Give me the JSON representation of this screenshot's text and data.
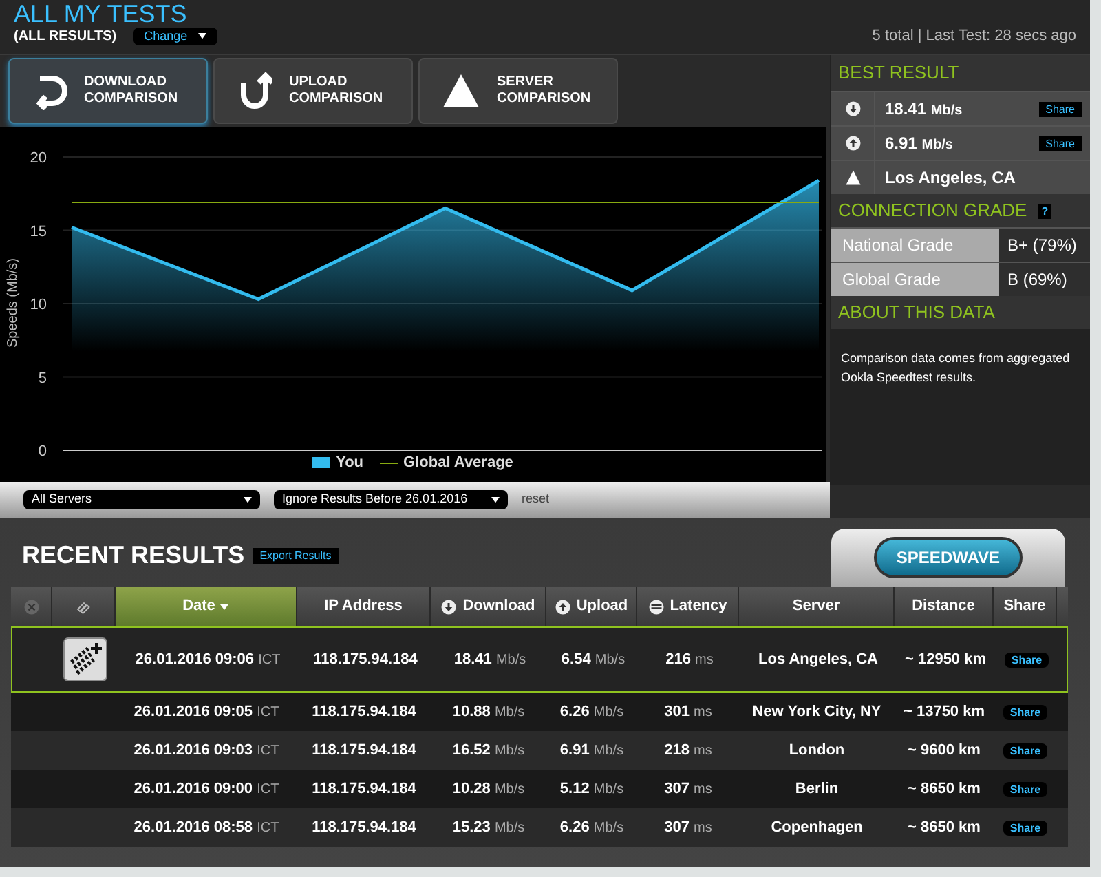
{
  "header": {
    "title": "ALL MY TESTS",
    "subtitle": "(ALL RESULTS)",
    "change_button": "Change",
    "summary": "5 total | Last Test: 28 secs ago"
  },
  "tabs": [
    {
      "label": "DOWNLOAD\nCOMPARISON",
      "kind": "download",
      "selected": true
    },
    {
      "label": "UPLOAD\nCOMPARISON",
      "kind": "upload",
      "selected": false
    },
    {
      "label": "SERVER\nCOMPARISON",
      "kind": "server",
      "selected": false
    }
  ],
  "chart": {
    "chart_data": {
      "type": "area",
      "ylabel": "Speeds (Mb/s)",
      "grid": true,
      "legend": "bottom",
      "ylim": [
        0,
        20
      ],
      "yticks": [
        0,
        5,
        10,
        15,
        20
      ],
      "series": [
        {
          "name": "You",
          "type": "area",
          "color": "#33bbee",
          "values": [
            15.2,
            10.3,
            16.5,
            10.9,
            18.4
          ]
        },
        {
          "name": "Global Average",
          "type": "line",
          "color": "#88aa11",
          "values": [
            16.9,
            16.9,
            16.9,
            16.9,
            16.9
          ]
        }
      ]
    }
  },
  "filters": {
    "server_select": "All Servers",
    "date_select": "Ignore Results Before 26.01.2016",
    "reset": "reset"
  },
  "best_result": {
    "title": "BEST RESULT",
    "rows": [
      {
        "kind": "download",
        "value": "18.41",
        "unit": "Mb/s",
        "share": "Share"
      },
      {
        "kind": "upload",
        "value": "6.91",
        "unit": "Mb/s",
        "share": "Share"
      },
      {
        "kind": "server",
        "value": "Los Angeles, CA"
      }
    ]
  },
  "connection_grade": {
    "title": "CONNECTION GRADE",
    "help": "?",
    "rows": [
      {
        "label": "National Grade",
        "value": "B+ (79%)"
      },
      {
        "label": "Global Grade",
        "value": "B (69%)"
      }
    ]
  },
  "about": {
    "title": "ABOUT THIS DATA",
    "text": "Comparison data comes from aggregated Ookla Speedtest results."
  },
  "recent": {
    "title": "RECENT RESULTS",
    "export_button": "Export Results",
    "speedwave_button": "SPEEDWAVE",
    "columns": [
      {
        "kind": "close",
        "selected": false
      },
      {
        "kind": "stack",
        "selected": false
      },
      {
        "label": "Date",
        "kind": "text",
        "selected": true
      },
      {
        "label": "IP Address",
        "kind": "text",
        "selected": false
      },
      {
        "label": "Download",
        "kind": "download",
        "selected": false
      },
      {
        "label": "Upload",
        "kind": "upload",
        "selected": false
      },
      {
        "label": "Latency",
        "kind": "latency",
        "selected": false
      },
      {
        "label": "Server",
        "kind": "text",
        "selected": false
      },
      {
        "label": "Distance",
        "kind": "text",
        "selected": false
      },
      {
        "label": "Share",
        "kind": "text",
        "selected": false
      }
    ],
    "rows": [
      {
        "selected": true,
        "date": "26.01.2016 09:06",
        "tz": "ICT",
        "ip": "118.175.94.184",
        "download": "18.41",
        "download_unit": "Mb/s",
        "upload": "6.54",
        "upload_unit": "Mb/s",
        "latency": "216",
        "latency_unit": "ms",
        "server": "Los Angeles, CA",
        "distance": "~ 12950 km",
        "share": "Share"
      },
      {
        "selected": false,
        "date": "26.01.2016 09:05",
        "tz": "ICT",
        "ip": "118.175.94.184",
        "download": "10.88",
        "download_unit": "Mb/s",
        "upload": "6.26",
        "upload_unit": "Mb/s",
        "latency": "301",
        "latency_unit": "ms",
        "server": "New York City, NY",
        "distance": "~ 13750 km",
        "share": "Share"
      },
      {
        "selected": false,
        "date": "26.01.2016 09:03",
        "tz": "ICT",
        "ip": "118.175.94.184",
        "download": "16.52",
        "download_unit": "Mb/s",
        "upload": "6.91",
        "upload_unit": "Mb/s",
        "latency": "218",
        "latency_unit": "ms",
        "server": "London",
        "distance": "~ 9600 km",
        "share": "Share"
      },
      {
        "selected": false,
        "date": "26.01.2016 09:00",
        "tz": "ICT",
        "ip": "118.175.94.184",
        "download": "10.28",
        "download_unit": "Mb/s",
        "upload": "5.12",
        "upload_unit": "Mb/s",
        "latency": "307",
        "latency_unit": "ms",
        "server": "Berlin",
        "distance": "~ 8650 km",
        "share": "Share"
      },
      {
        "selected": false,
        "date": "26.01.2016 08:58",
        "tz": "ICT",
        "ip": "118.175.94.184",
        "download": "15.23",
        "download_unit": "Mb/s",
        "upload": "6.26",
        "upload_unit": "Mb/s",
        "latency": "307",
        "latency_unit": "ms",
        "server": "Copenhagen",
        "distance": "~ 8650 km",
        "share": "Share"
      }
    ]
  }
}
